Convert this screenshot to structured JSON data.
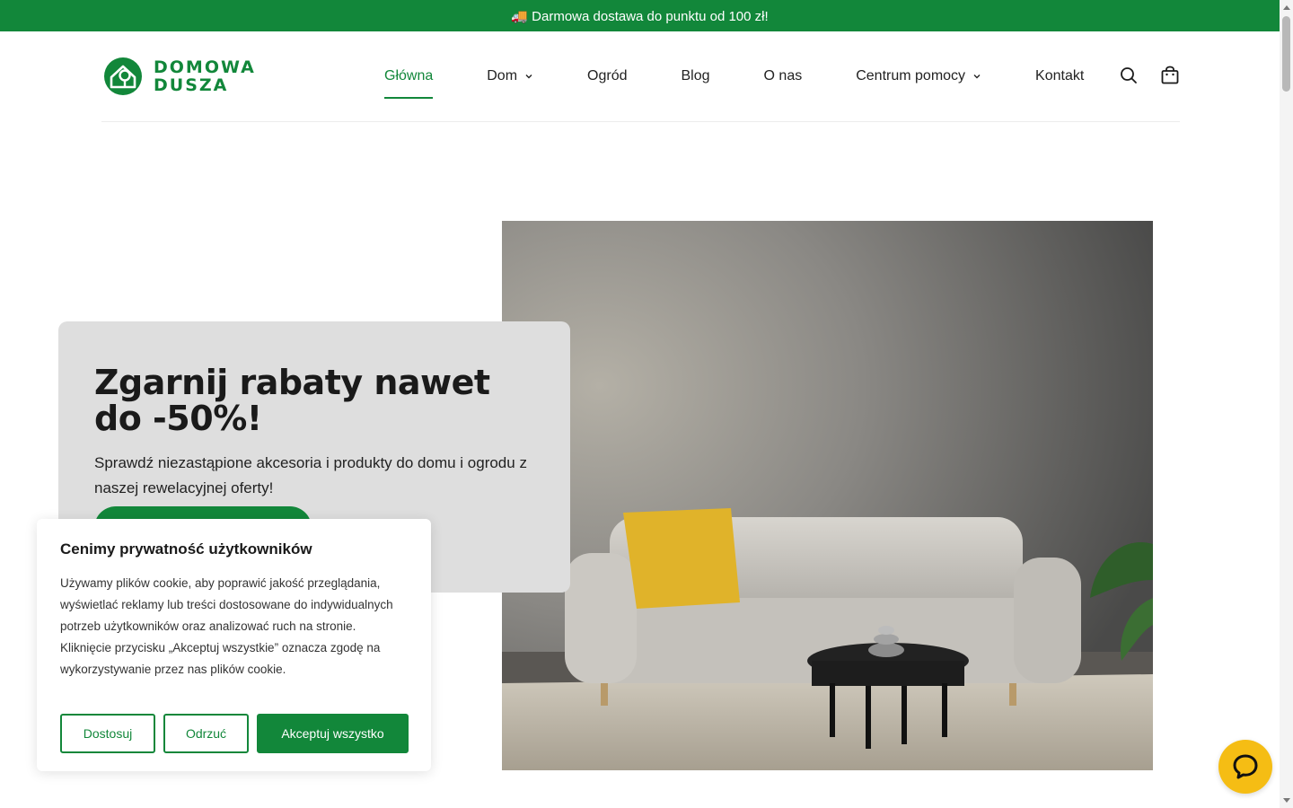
{
  "announcement": "🚚 Darmowa dostawa do punktu od 100 zł!",
  "brand": {
    "line1": "DOMOWA",
    "line2": "DUSZA"
  },
  "nav": [
    {
      "label": "Główna",
      "active": true,
      "dropdown": false
    },
    {
      "label": "Dom",
      "active": false,
      "dropdown": true
    },
    {
      "label": "Ogród",
      "active": false,
      "dropdown": false
    },
    {
      "label": "Blog",
      "active": false,
      "dropdown": false
    },
    {
      "label": "O nas",
      "active": false,
      "dropdown": false
    },
    {
      "label": "Centrum pomocy",
      "active": false,
      "dropdown": true
    },
    {
      "label": "Kontakt",
      "active": false,
      "dropdown": false
    }
  ],
  "header_icons": [
    "search-icon",
    "shopping-bag-icon"
  ],
  "hero": {
    "title": "Zgarnij rabaty nawet do -50%!",
    "text": "Sprawdź niezastąpione akcesoria i produkty do domu i ogrodu z naszej rewelacyjnej oferty!",
    "image": "living-room-sofa-photo"
  },
  "cookie": {
    "title": "Cenimy prywatność użytkowników",
    "body": "Używamy plików cookie, aby poprawić jakość przeglądania, wyświetlać reklamy lub treści dostosowane do indywidualnych potrzeb użytkowników oraz analizować ruch na stronie. Kliknięcie przycisku „Akceptuj wszystkie” oznacza zgodę na wykorzystywanie przez nas plików cookie.",
    "customize": "Dostosuj",
    "reject": "Odrzuć",
    "accept": "Akceptuj wszystko"
  },
  "colors": {
    "brand_green": "#12873a",
    "chat_yellow": "#f5bd14",
    "promo_bg": "#dedede"
  }
}
